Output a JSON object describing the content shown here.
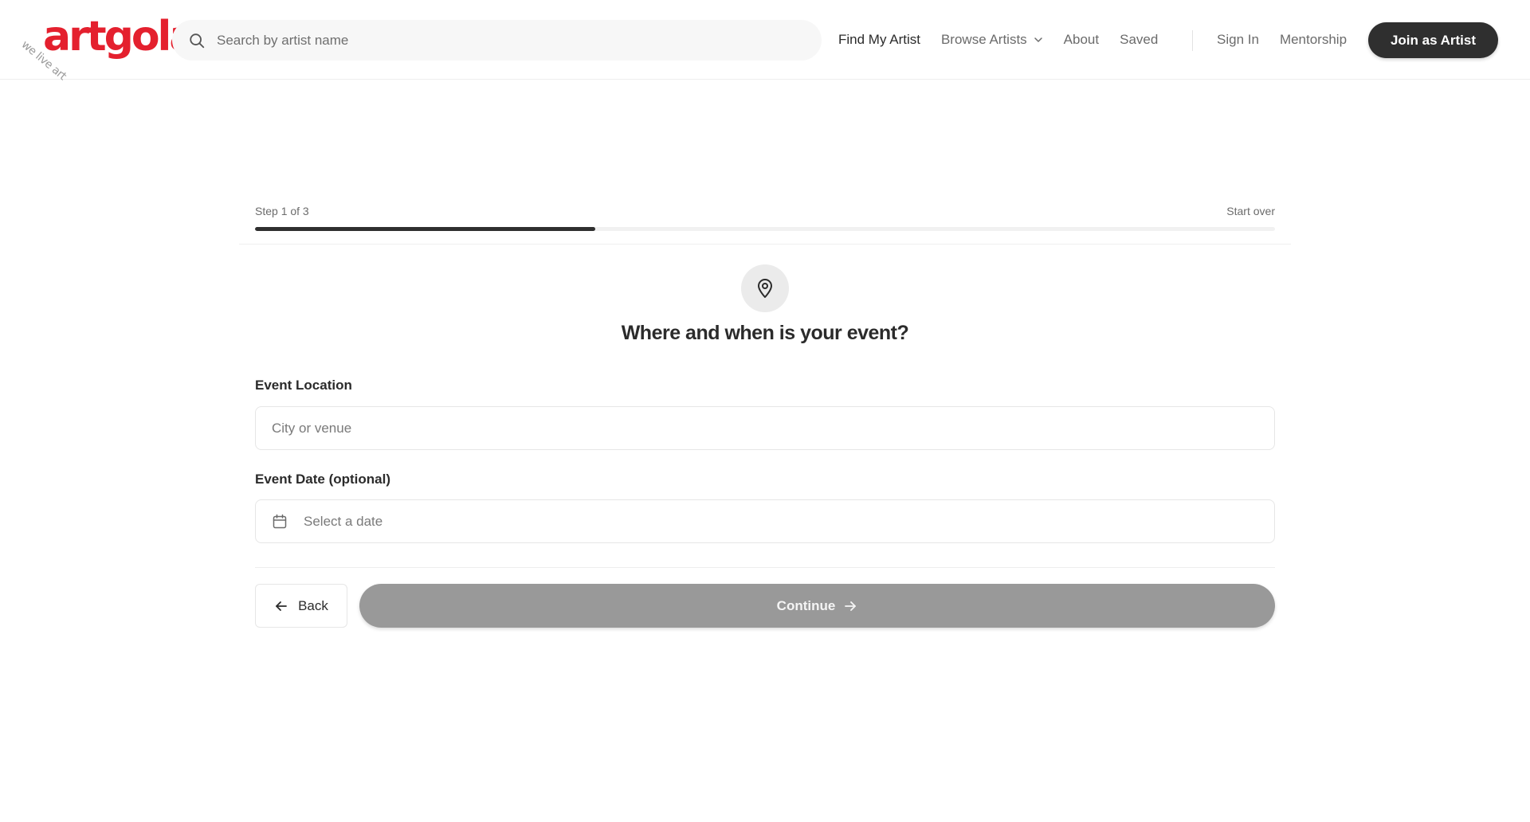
{
  "brand": {
    "logo_text": "artgola",
    "tagline": "we live art",
    "accent_color": "#e4202e"
  },
  "header": {
    "search": {
      "placeholder": "Search by artist name",
      "value": "",
      "icon": "search-icon"
    },
    "nav": {
      "find_my_artist": "Find My Artist",
      "browse_artists": "Browse Artists",
      "about": "About",
      "saved": "Saved",
      "sign_in": "Sign In",
      "mentorship": "Mentorship"
    },
    "join_button": "Join as Artist"
  },
  "wizard": {
    "step_label": "Step 1 of 3",
    "start_over": "Start over",
    "progress": {
      "current": 1,
      "total": 3
    },
    "icon": "map-pin-icon",
    "question": "Where and when is your event?",
    "location": {
      "label": "Event Location",
      "placeholder": "City or venue",
      "value": ""
    },
    "date": {
      "label": "Event Date (optional)",
      "placeholder": "Select a date",
      "value": "",
      "icon": "calendar-icon"
    },
    "back_button": "Back",
    "continue_button": "Continue",
    "continue_enabled": false
  }
}
